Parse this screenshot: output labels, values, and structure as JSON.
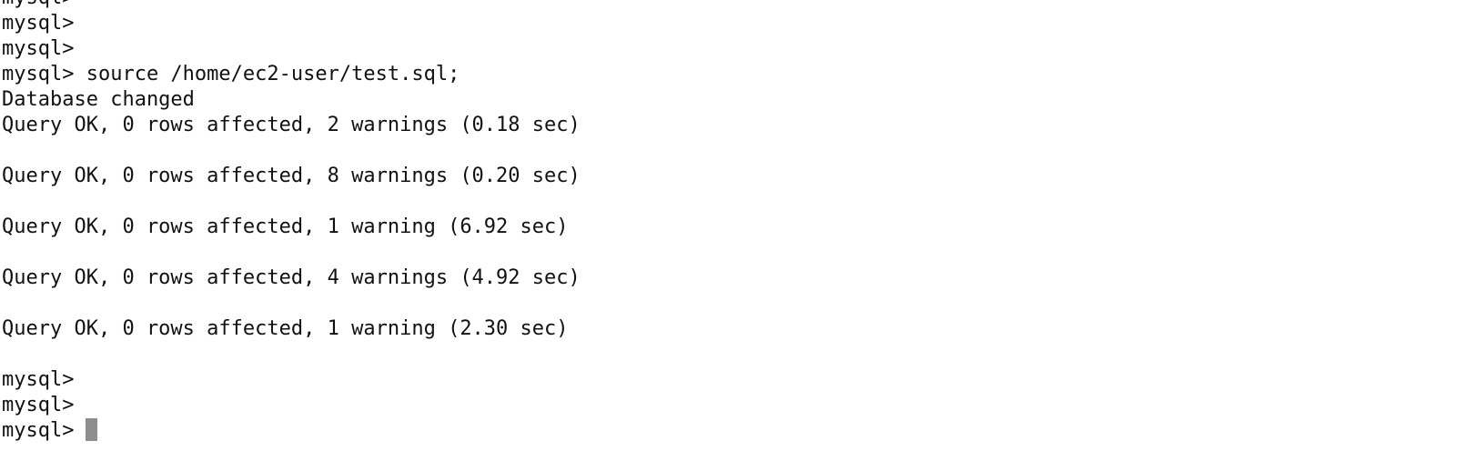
{
  "terminal": {
    "lines": [
      "mysql>",
      "mysql>",
      "mysql>",
      "mysql> source /home/ec2-user/test.sql;",
      "Database changed",
      "Query OK, 0 rows affected, 2 warnings (0.18 sec)",
      "",
      "Query OK, 0 rows affected, 8 warnings (0.20 sec)",
      "",
      "Query OK, 0 rows affected, 1 warning (6.92 sec)",
      "",
      "Query OK, 0 rows affected, 4 warnings (4.92 sec)",
      "",
      "Query OK, 0 rows affected, 1 warning (2.30 sec)",
      "",
      "mysql>",
      "mysql>"
    ],
    "prompt": "mysql>",
    "cursor_color": "#8e8e8e",
    "background_color": "#ffffff",
    "text_color": "#111111"
  }
}
